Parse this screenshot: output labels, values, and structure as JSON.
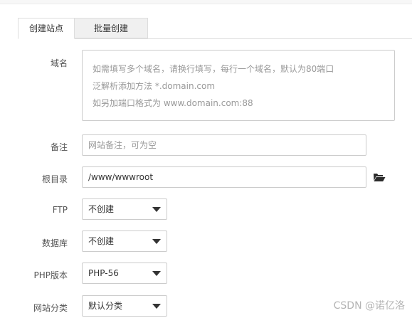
{
  "tabs": {
    "create_site": "创建站点",
    "batch_create": "批量创建"
  },
  "form": {
    "domain": {
      "label": "域名",
      "hint_line1": "如需填写多个域名，请换行填写，每行一个域名，默认为80端口",
      "hint_line2": "泛解析添加方法 *.domain.com",
      "hint_line3": "如另加端口格式为 www.domain.com:88"
    },
    "remark": {
      "label": "备注",
      "placeholder": "网站备注，可为空"
    },
    "root_dir": {
      "label": "根目录",
      "value": "/www/wwwroot"
    },
    "ftp": {
      "label": "FTP",
      "selected": "不创建"
    },
    "database": {
      "label": "数据库",
      "selected": "不创建"
    },
    "php_version": {
      "label": "PHP版本",
      "selected": "PHP-56"
    },
    "site_category": {
      "label": "网站分类",
      "selected": "默认分类"
    }
  },
  "icons": {
    "folder": "folder-open-icon",
    "dropdown": "caret-down-icon"
  },
  "watermark": "CSDN @诺亿洛"
}
